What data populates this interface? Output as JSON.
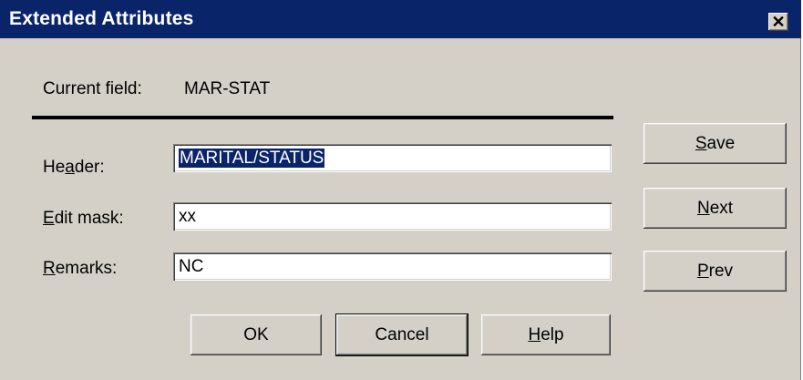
{
  "window": {
    "title": "Extended Attributes",
    "close_glyph": "✕"
  },
  "current_field": {
    "label": "Current field:",
    "value": "MAR-STAT"
  },
  "form": {
    "header": {
      "label_pre": "He",
      "label_mnemonic": "a",
      "label_post": "der:",
      "value": "MARITAL/STATUS"
    },
    "edit_mask": {
      "label_mnemonic": "E",
      "label_post": "dit mask:",
      "value": "xx"
    },
    "remarks": {
      "label_mnemonic": "R",
      "label_post": "emarks:",
      "value": "NC"
    }
  },
  "side_buttons": {
    "save": {
      "mnemonic": "S",
      "rest": "ave"
    },
    "next": {
      "mnemonic": "N",
      "rest": "ext"
    },
    "prev": {
      "mnemonic": "P",
      "rest": "rev"
    }
  },
  "bottom_buttons": {
    "ok": "OK",
    "cancel": "Cancel",
    "help": {
      "mnemonic": "H",
      "rest": "elp"
    }
  },
  "colors": {
    "dialog_bg": "#d4d0c8",
    "titlebar_bg": "#0a246a",
    "selection_bg": "#0a246a"
  }
}
